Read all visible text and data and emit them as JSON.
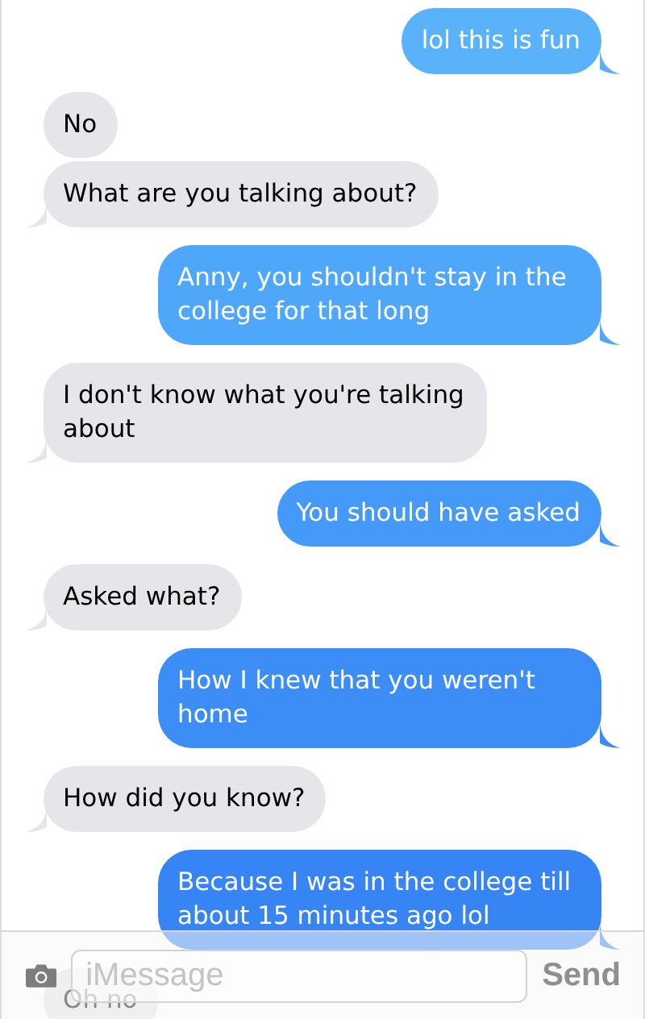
{
  "messages": [
    {
      "kind": "sent",
      "text": "lol this is fun",
      "tail": true,
      "color": "#5ab3fa"
    },
    {
      "kind": "received",
      "text": "No",
      "tail": false
    },
    {
      "kind": "received",
      "text": "What are you talking about?",
      "tail": true
    },
    {
      "kind": "sent",
      "text": "Anny, you shouldn't stay in the college for that long",
      "tail": true,
      "color": "#4ea7fa"
    },
    {
      "kind": "received",
      "text": "I don't know what you're talking about",
      "tail": true
    },
    {
      "kind": "sent",
      "text": "You should have asked",
      "tail": true,
      "color": "#4599f8"
    },
    {
      "kind": "received",
      "text": "Asked what?",
      "tail": true
    },
    {
      "kind": "sent",
      "text": "How I knew that you weren't home",
      "tail": true,
      "color": "#3d8df6"
    },
    {
      "kind": "received",
      "text": "How did you know?",
      "tail": true
    },
    {
      "kind": "sent",
      "text": "Because I was in the college till about 15 minutes ago lol",
      "tail": true,
      "color": "#3784f5"
    },
    {
      "kind": "received",
      "text": "Oh no",
      "tail": false
    }
  ],
  "composer": {
    "placeholder": "iMessage",
    "send": "Send"
  }
}
